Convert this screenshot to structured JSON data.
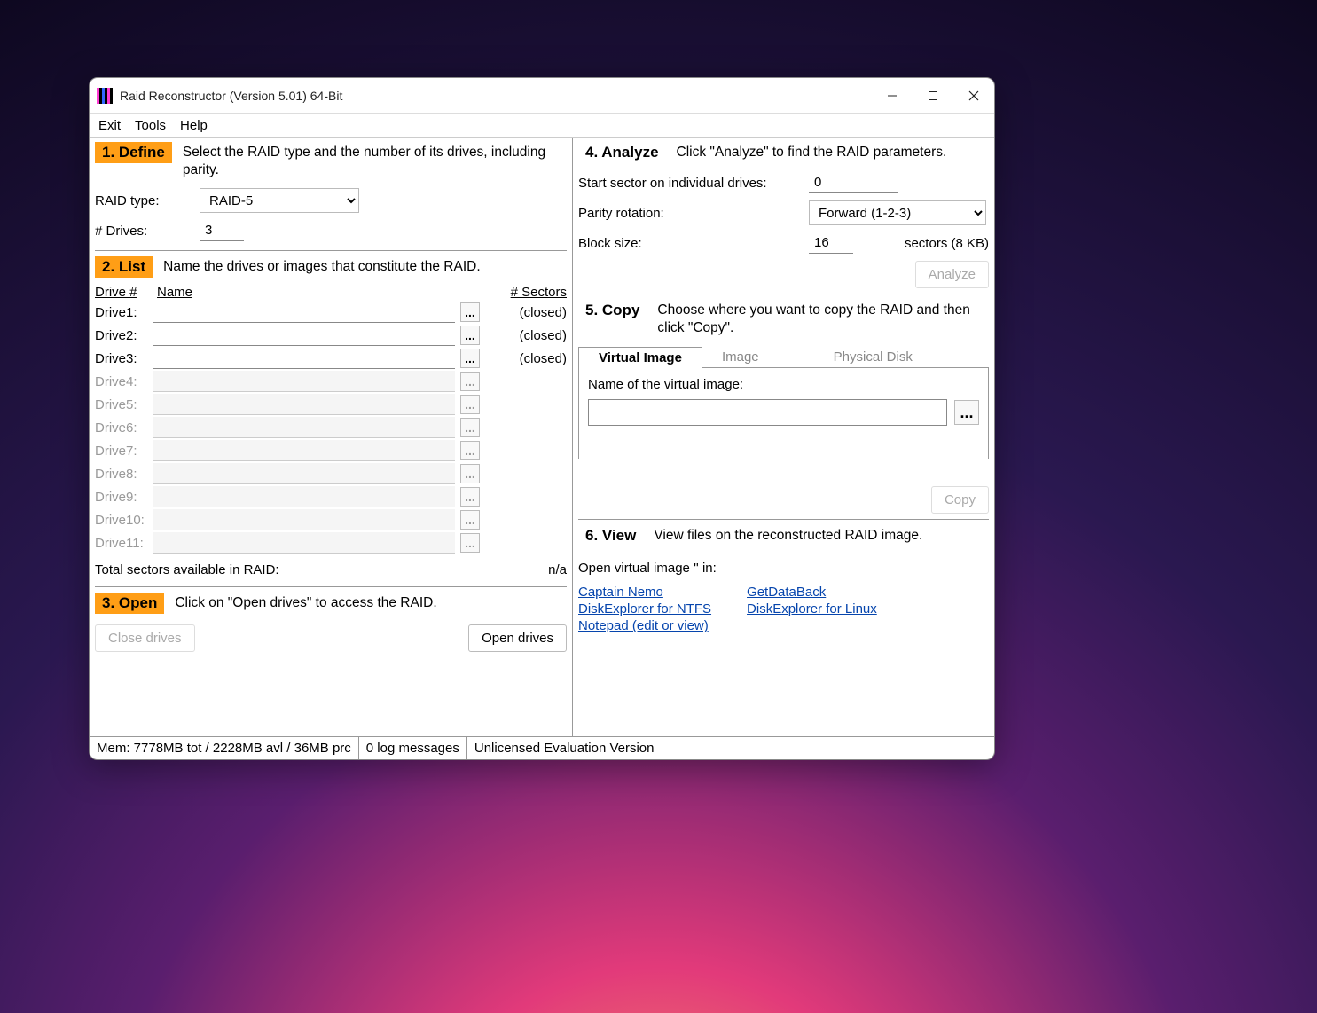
{
  "window": {
    "title": "Raid Reconstructor (Version 5.01) 64-Bit"
  },
  "menu": {
    "exit": "Exit",
    "tools": "Tools",
    "help": "Help"
  },
  "s1": {
    "label": "1. Define",
    "desc": "Select the RAID type and the number of its drives, including parity.",
    "raid_type_label": "RAID type:",
    "raid_type_value": "RAID-5",
    "drives_label": "# Drives:",
    "drives_value": "3"
  },
  "s2": {
    "label": "2. List",
    "desc": "Name the drives or images that constitute the RAID.",
    "hdr_drive": "Drive #",
    "hdr_name": "Name",
    "hdr_sectors": "# Sectors",
    "drives": [
      {
        "label": "Drive1:",
        "value": "",
        "status": "(closed)",
        "enabled": true
      },
      {
        "label": "Drive2:",
        "value": "",
        "status": "(closed)",
        "enabled": true
      },
      {
        "label": "Drive3:",
        "value": "",
        "status": "(closed)",
        "enabled": true
      },
      {
        "label": "Drive4:",
        "value": "",
        "status": "",
        "enabled": false
      },
      {
        "label": "Drive5:",
        "value": "",
        "status": "",
        "enabled": false
      },
      {
        "label": "Drive6:",
        "value": "",
        "status": "",
        "enabled": false
      },
      {
        "label": "Drive7:",
        "value": "",
        "status": "",
        "enabled": false
      },
      {
        "label": "Drive8:",
        "value": "",
        "status": "",
        "enabled": false
      },
      {
        "label": "Drive9:",
        "value": "",
        "status": "",
        "enabled": false
      },
      {
        "label": "Drive10:",
        "value": "",
        "status": "",
        "enabled": false
      },
      {
        "label": "Drive11:",
        "value": "",
        "status": "",
        "enabled": false
      }
    ],
    "totals_label": "Total sectors available in RAID:",
    "totals_value": "n/a"
  },
  "s3": {
    "label": "3. Open",
    "desc": "Click on \"Open drives\" to access the RAID.",
    "close_btn": "Close drives",
    "open_btn": "Open drives"
  },
  "s4": {
    "label": "4. Analyze",
    "desc": "Click \"Analyze\" to find the RAID parameters.",
    "start_sector_label": "Start sector on individual drives:",
    "start_sector_value": "0",
    "parity_label": "Parity rotation:",
    "parity_value": "Forward (1-2-3)",
    "block_label": "Block size:",
    "block_value": "16",
    "block_suffix": "sectors (8 KB)",
    "analyze_btn": "Analyze"
  },
  "s5": {
    "label": "5. Copy",
    "desc": "Choose where you want to copy the RAID and then click \"Copy\".",
    "tab_vi": "Virtual Image",
    "tab_img": "Image",
    "tab_pd": "Physical Disk",
    "vi_label": "Name of the virtual image:",
    "vi_value": "",
    "copy_btn": "Copy"
  },
  "s6": {
    "label": "6. View",
    "desc": "View files on the reconstructed RAID image.",
    "open_in": "Open virtual image '' in:",
    "links_l": [
      "Captain Nemo",
      "DiskExplorer for NTFS",
      "Notepad (edit or view)"
    ],
    "links_r": [
      "GetDataBack",
      "DiskExplorer for Linux"
    ]
  },
  "status": {
    "mem": "Mem: 7778MB tot / 2228MB avl / 36MB prc",
    "log": "0 log messages",
    "lic": "Unlicensed Evaluation Version"
  },
  "browse_glyph": "..."
}
